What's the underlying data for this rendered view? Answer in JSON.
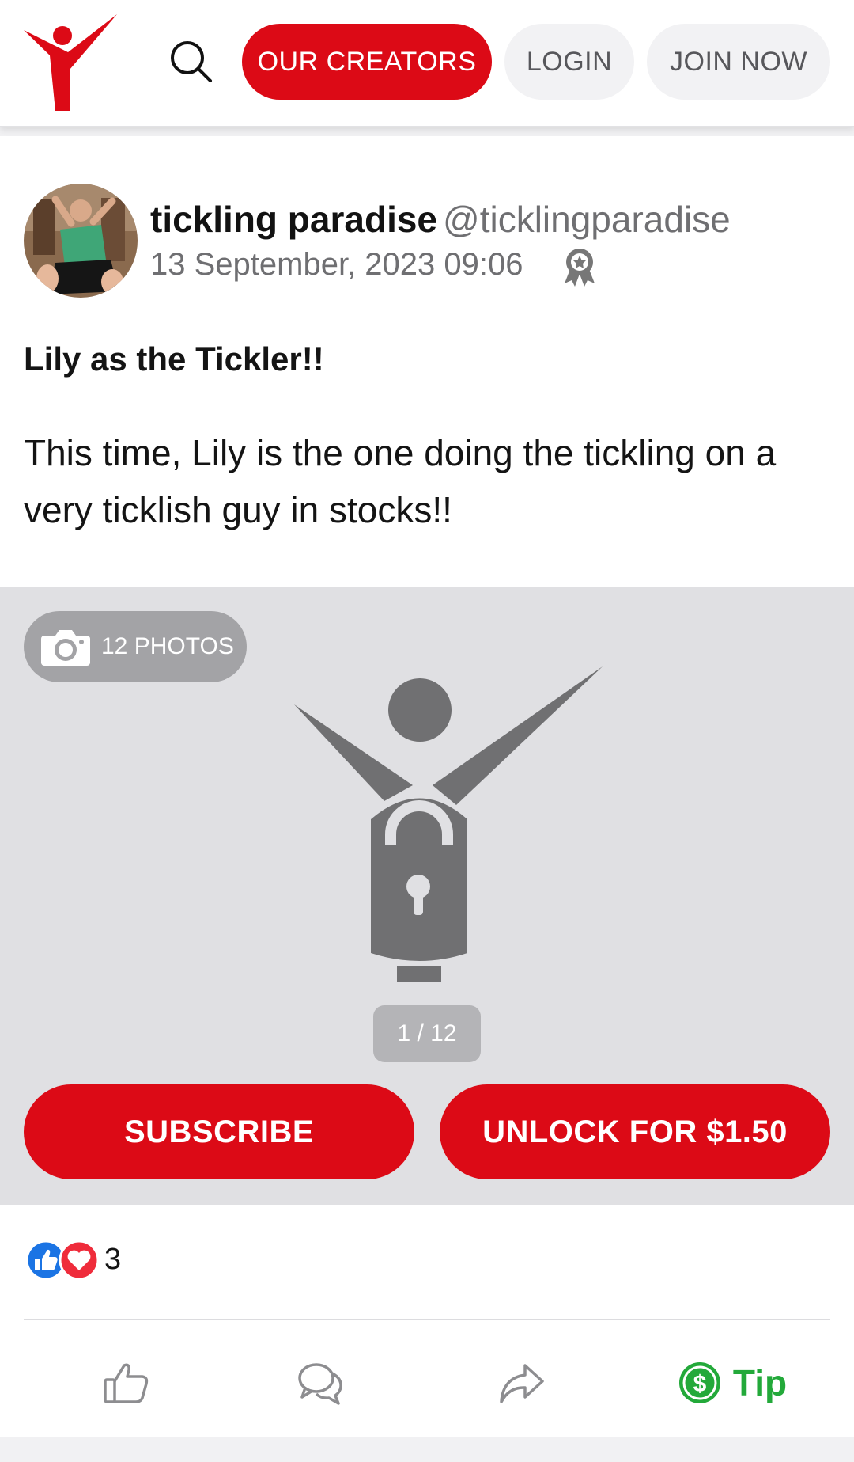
{
  "header": {
    "logo_icon": "brand-logo-icon",
    "search_icon": "search-icon",
    "nav": {
      "our_creators": "OUR CREATORS",
      "login": "LOGIN",
      "join_now": "JOIN NOW"
    }
  },
  "post": {
    "author": {
      "name": "tickling paradise",
      "handle": "@ticklingparadise"
    },
    "date": "13 September, 2023 09:06",
    "badge_icon": "verified-award-icon",
    "title": "Lily as the Tickler!!",
    "body": "This time, Lily is the one doing the tickling on a very ticklish guy in stocks!!",
    "media": {
      "photo_count_label": "12 PHOTOS",
      "pager": "1 / 12",
      "locked": true
    },
    "buttons": {
      "subscribe": "SUBSCRIBE",
      "unlock": "UNLOCK FOR $1.50"
    },
    "reactions": {
      "count": "3",
      "types": [
        "like",
        "love"
      ]
    },
    "actions": {
      "like_icon": "thumbs-up-icon",
      "comment_icon": "comment-icon",
      "share_icon": "share-icon",
      "tip_label": "Tip"
    }
  },
  "colors": {
    "brand_red": "#dc0a16",
    "pill_gray": "#f2f2f4",
    "lock_gray": "#707072",
    "media_bg": "#e0e0e3",
    "tip_green": "#23a93a",
    "like_blue": "#1b74e4",
    "heart_red": "#ef2c3b"
  }
}
